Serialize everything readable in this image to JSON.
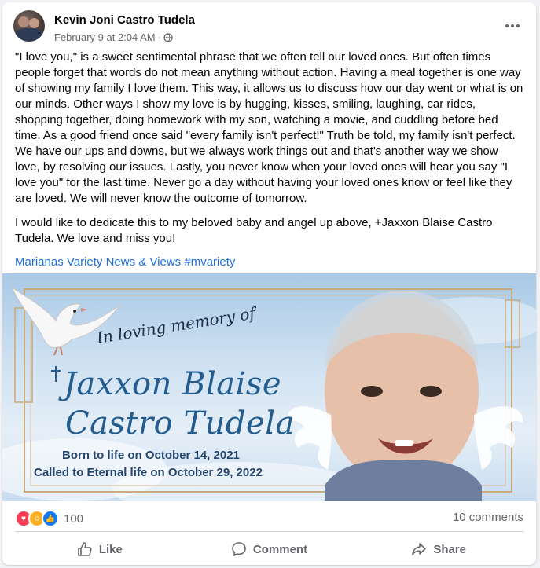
{
  "post": {
    "author": "Kevin Joni Castro Tudela",
    "timestamp": "February 9 at 2:04 AM",
    "separator": "·",
    "privacy_icon": "globe-icon",
    "more_icon": "more-options-icon",
    "paragraphs": [
      "\"I love you,\" is a sweet sentimental phrase that we often tell our loved ones. But often times people forget that words do not mean anything without action. Having a meal together is one way of showing my family I love them. This way, it allows us to discuss how our day went or what is on our minds. Other ways I show my love is by hugging, kisses, smiling, laughing, car rides, shopping together, doing homework with my son, watching a movie, and cuddling before bed time. As a good friend once said \"every family isn't perfect!\" Truth be told, my family isn't perfect. We have our ups and downs, but we always work things out and that's another way we show love, by resolving our issues. Lastly, you never know when your loved ones will hear you say \"I love you\" for the last time. Never go a day without having your loved ones know or feel like they are loved. We will never know the outcome of tomorrow.",
      "I would like to dedicate this to my beloved baby and angel up above, +Jaxxon Blaise Castro Tudela. We love and miss you!"
    ],
    "link_text": "Marianas Variety News & Views #mvariety"
  },
  "memorial": {
    "memory_label": "In loving memory of",
    "name_line1": "Jaxxon Blaise",
    "name_line2": "Castro Tudela",
    "born": "Born to life on October 14, 2021",
    "called": "Called to Eternal life on October 29, 2022"
  },
  "stats": {
    "reaction_icons": [
      "love-reaction-icon",
      "care-reaction-icon",
      "like-reaction-icon"
    ],
    "reaction_count": "100",
    "comments": "10 comments"
  },
  "actions": {
    "like": "Like",
    "comment": "Comment",
    "share": "Share"
  },
  "colors": {
    "link": "#216fdb",
    "muted": "#65676b",
    "memorial_name": "#235c8e"
  }
}
